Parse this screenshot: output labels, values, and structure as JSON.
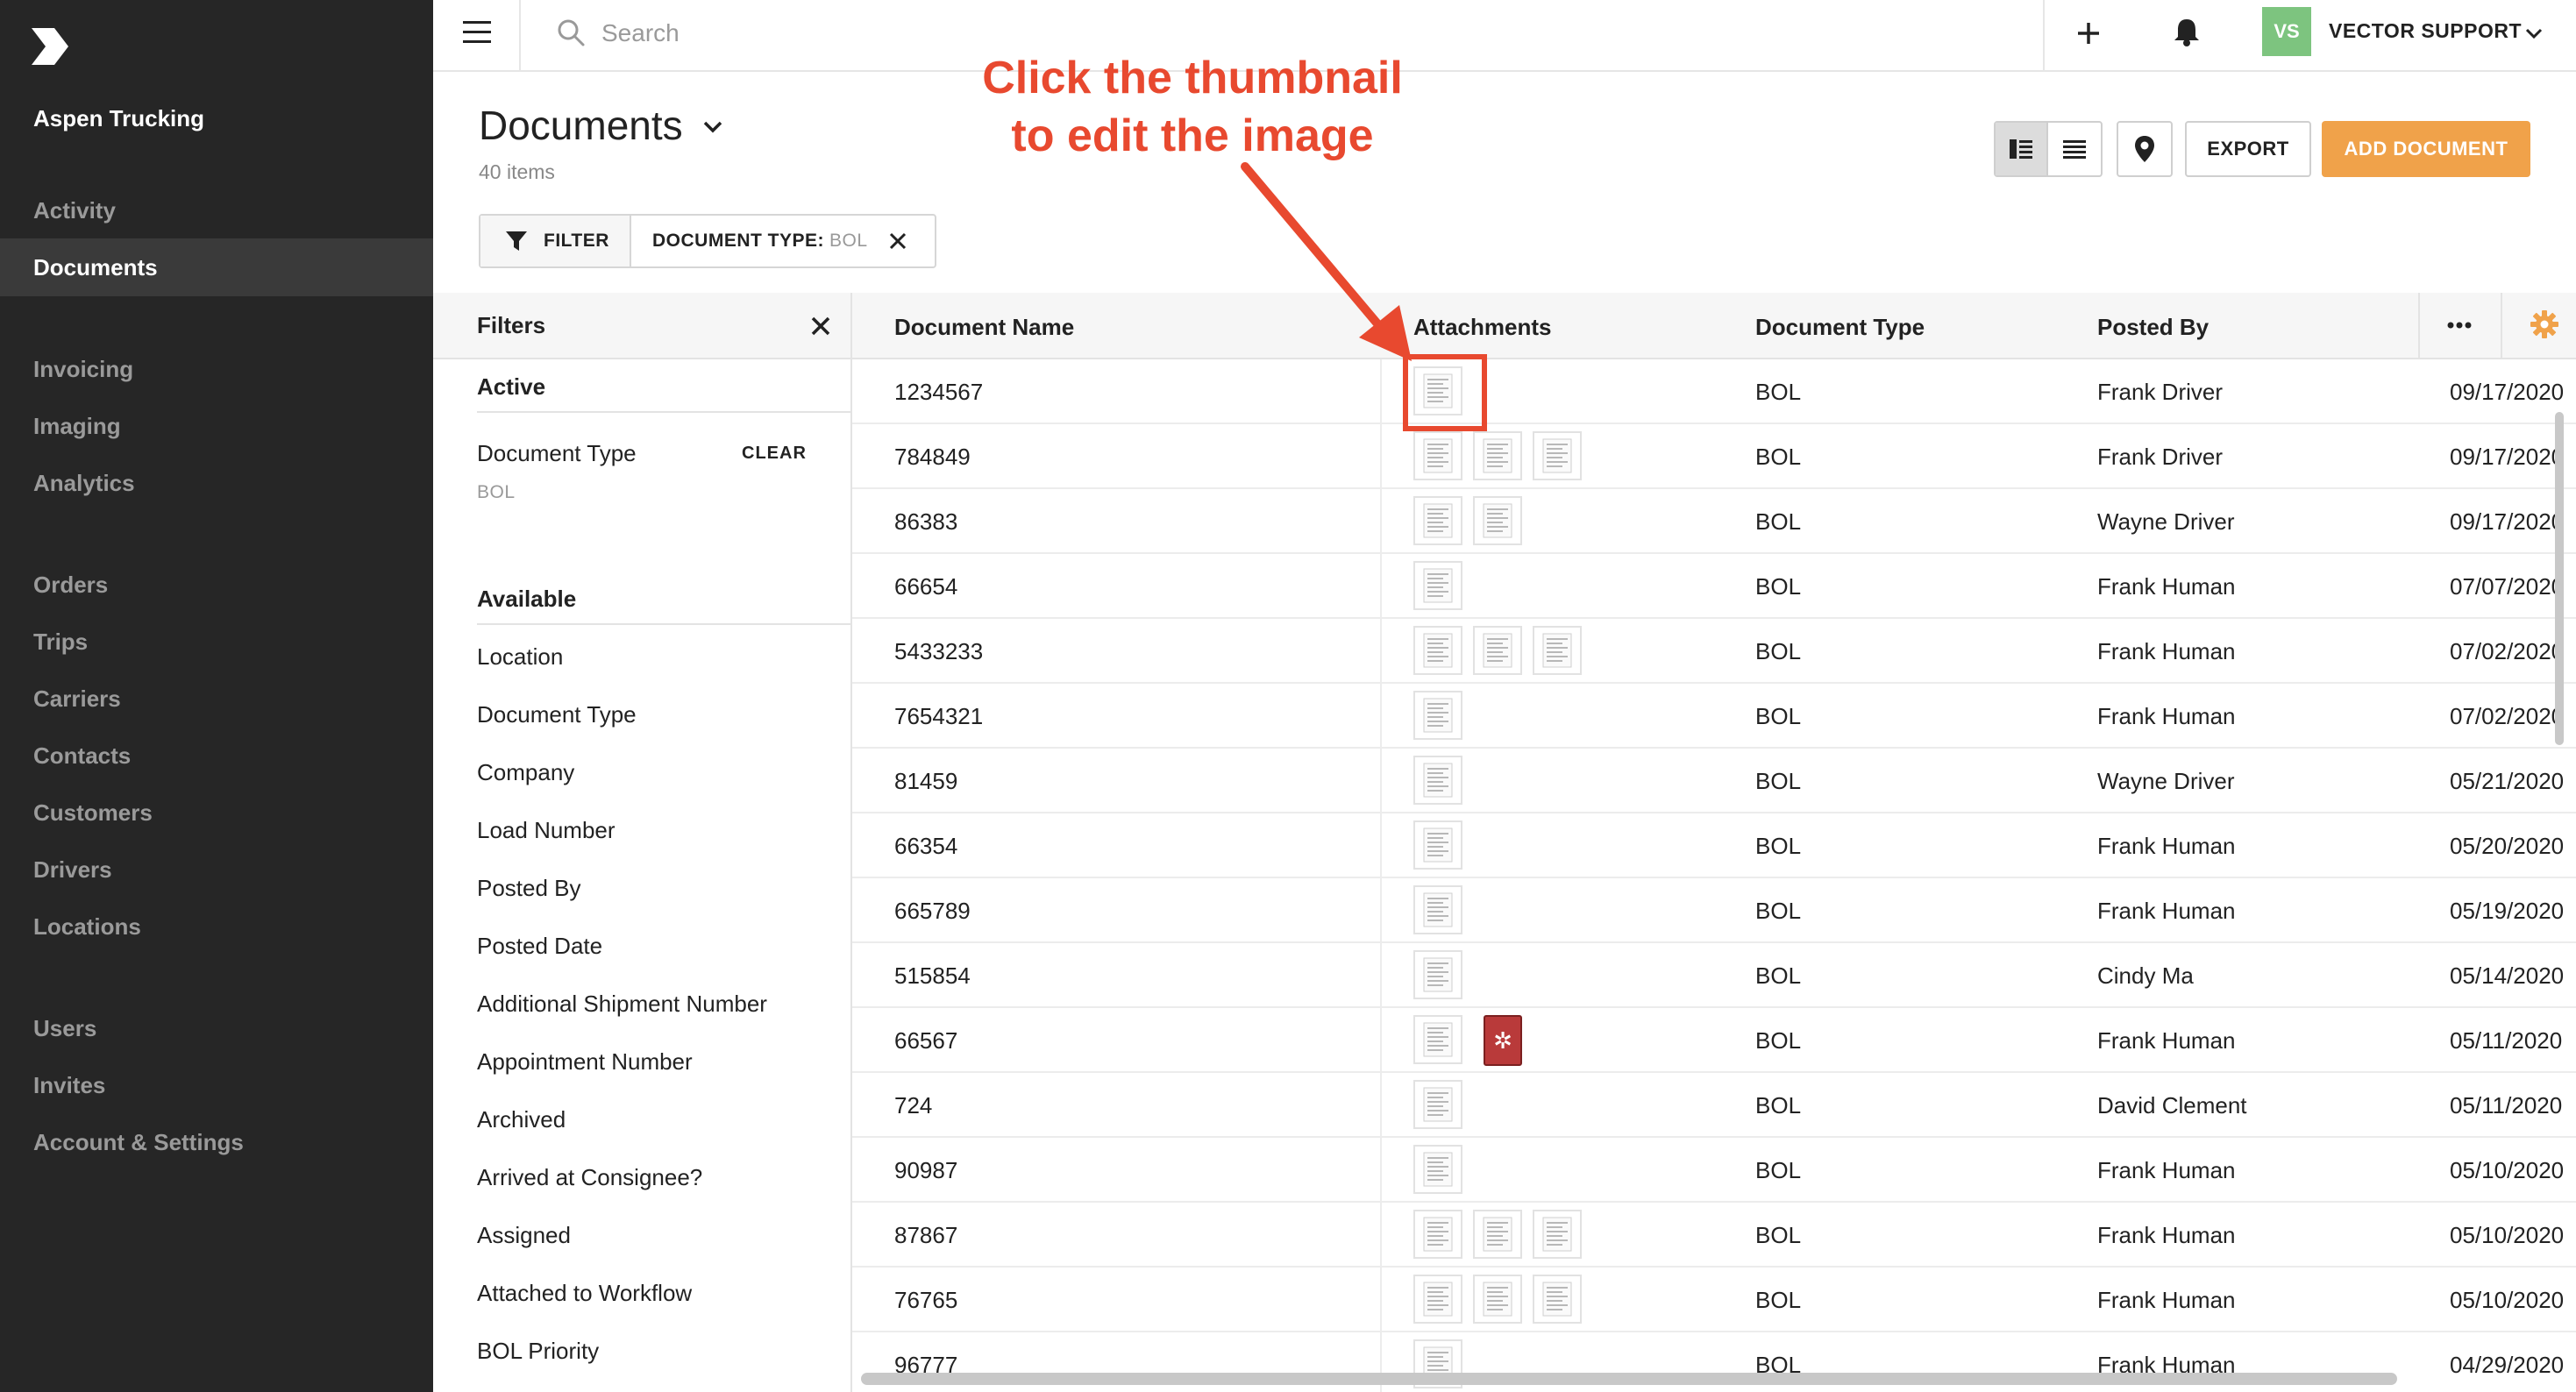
{
  "sidebar": {
    "company": "Aspen Trucking",
    "items": [
      {
        "label": "Activity",
        "active": false
      },
      {
        "label": "Documents",
        "active": true
      },
      {
        "label": "Invoicing",
        "active": false
      },
      {
        "label": "Imaging",
        "active": false
      },
      {
        "label": "Analytics",
        "active": false
      },
      {
        "label": "Orders",
        "active": false
      },
      {
        "label": "Trips",
        "active": false
      },
      {
        "label": "Carriers",
        "active": false
      },
      {
        "label": "Contacts",
        "active": false
      },
      {
        "label": "Customers",
        "active": false
      },
      {
        "label": "Drivers",
        "active": false
      },
      {
        "label": "Locations",
        "active": false
      },
      {
        "label": "Users",
        "active": false
      },
      {
        "label": "Invites",
        "active": false
      },
      {
        "label": "Account & Settings",
        "active": false
      }
    ]
  },
  "topbar": {
    "search_placeholder": "Search",
    "avatar_initials": "VS",
    "user_name": "VECTOR SUPPORT"
  },
  "header": {
    "title": "Documents",
    "count": "40 items",
    "filter_label": "FILTER",
    "chip_key": "DOCUMENT TYPE:",
    "chip_value": "BOL",
    "export_label": "EXPORT",
    "add_label": "ADD DOCUMENT"
  },
  "annotation": {
    "line1": "Click the thumbnail",
    "line2": "to edit the image",
    "color": "#e8492f"
  },
  "filters": {
    "title": "Filters",
    "active_heading": "Active",
    "active_field": "Document Type",
    "clear_label": "CLEAR",
    "active_value": "BOL",
    "available_heading": "Available",
    "available": [
      "Location",
      "Document Type",
      "Company",
      "Load Number",
      "Posted By",
      "Posted Date",
      "Additional Shipment Number",
      "Appointment Number",
      "Archived",
      "Arrived at Consignee?",
      "Assigned",
      "Attached to Workflow",
      "BOL Priority"
    ]
  },
  "table": {
    "columns": [
      "Document Name",
      "Attachments",
      "Document Type",
      "Posted By"
    ],
    "rows": [
      {
        "name": "1234567",
        "thumbs": 1,
        "pdf": false,
        "type": "BOL",
        "posted_by": "Frank Driver",
        "date": "09/17/2020"
      },
      {
        "name": "784849",
        "thumbs": 3,
        "pdf": false,
        "type": "BOL",
        "posted_by": "Frank Driver",
        "date": "09/17/2020"
      },
      {
        "name": "86383",
        "thumbs": 2,
        "pdf": false,
        "type": "BOL",
        "posted_by": "Wayne Driver",
        "date": "09/17/2020"
      },
      {
        "name": "66654",
        "thumbs": 1,
        "pdf": false,
        "type": "BOL",
        "posted_by": "Frank Human",
        "date": "07/07/2020"
      },
      {
        "name": "5433233",
        "thumbs": 3,
        "pdf": false,
        "type": "BOL",
        "posted_by": "Frank Human",
        "date": "07/02/2020"
      },
      {
        "name": "7654321",
        "thumbs": 1,
        "pdf": false,
        "type": "BOL",
        "posted_by": "Frank Human",
        "date": "07/02/2020"
      },
      {
        "name": "81459",
        "thumbs": 1,
        "pdf": false,
        "type": "BOL",
        "posted_by": "Wayne Driver",
        "date": "05/21/2020"
      },
      {
        "name": "66354",
        "thumbs": 1,
        "pdf": false,
        "type": "BOL",
        "posted_by": "Frank Human",
        "date": "05/20/2020"
      },
      {
        "name": "665789",
        "thumbs": 1,
        "pdf": false,
        "type": "BOL",
        "posted_by": "Frank Human",
        "date": "05/19/2020"
      },
      {
        "name": "515854",
        "thumbs": 1,
        "pdf": false,
        "type": "BOL",
        "posted_by": "Cindy Ma",
        "date": "05/14/2020"
      },
      {
        "name": "66567",
        "thumbs": 1,
        "pdf": true,
        "type": "BOL",
        "posted_by": "Frank Human",
        "date": "05/11/2020"
      },
      {
        "name": "724",
        "thumbs": 1,
        "pdf": false,
        "type": "BOL",
        "posted_by": "David Clement",
        "date": "05/11/2020"
      },
      {
        "name": "90987",
        "thumbs": 1,
        "pdf": false,
        "type": "BOL",
        "posted_by": "Frank Human",
        "date": "05/10/2020"
      },
      {
        "name": "87867",
        "thumbs": 3,
        "pdf": false,
        "type": "BOL",
        "posted_by": "Frank Human",
        "date": "05/10/2020"
      },
      {
        "name": "76765",
        "thumbs": 3,
        "pdf": false,
        "type": "BOL",
        "posted_by": "Frank Human",
        "date": "05/10/2020"
      },
      {
        "name": "96777",
        "thumbs": 1,
        "pdf": false,
        "type": "BOL",
        "posted_by": "Frank Human",
        "date": "04/29/2020"
      }
    ]
  },
  "icons": {
    "logo": "logo-icon",
    "menu": "hamburger-icon",
    "search": "search-icon",
    "add": "plus-icon",
    "notifications": "bell-icon",
    "more": "more-icon",
    "settings": "gear-icon"
  },
  "colors": {
    "accent": "#f0a24a",
    "avatar": "#7dc47f",
    "sidebar": "#262626"
  }
}
